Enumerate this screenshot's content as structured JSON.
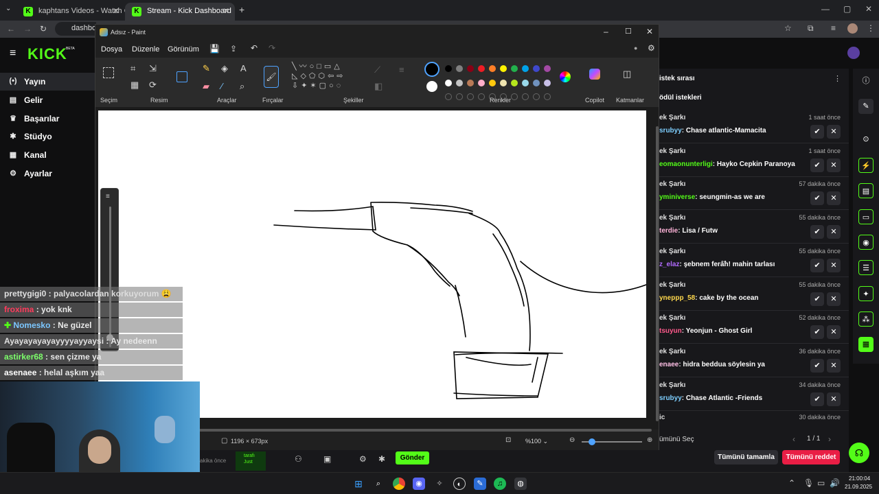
{
  "browser": {
    "tabs": [
      {
        "label": "kaphtans Videos - Watch On-D",
        "active": false
      },
      {
        "label": "Stream - Kick Dashboard",
        "active": true
      }
    ],
    "address": "dashboa"
  },
  "kick": {
    "logo": "KICK",
    "beta": "BETA",
    "nav": [
      {
        "label": "Yayın",
        "icon": "broadcast-icon",
        "glyph": "(•)"
      },
      {
        "label": "Gelir",
        "icon": "revenue-icon",
        "glyph": "▤"
      },
      {
        "label": "Başarılar",
        "icon": "trophy-icon",
        "glyph": "🏆"
      },
      {
        "label": "Stüdyo",
        "icon": "studio-icon",
        "glyph": "✱"
      },
      {
        "label": "Kanal",
        "icon": "channel-icon",
        "glyph": "▦"
      },
      {
        "label": "Ayarlar",
        "icon": "settings-icon",
        "glyph": "⚙"
      }
    ],
    "accent": "#53fc18"
  },
  "chat_overlay": [
    {
      "user": "prettygigi0",
      "color": "#e0e0e0",
      "text": "palyacolardan korkuyorum 😩"
    },
    {
      "user": "froxima",
      "color": "#ff3b5c",
      "text": "yok knk"
    },
    {
      "user": "Nomesko",
      "color": "#7cc7ff",
      "text": "Ne güzel",
      "badge": "✚"
    },
    {
      "user": "Ayayayayayayyyyayyaysi",
      "color": "#e0e0e0",
      "text": "Ay nedeenn"
    },
    {
      "user": "astirker68",
      "color": "#7dff6b",
      "text": "sen çizme ya"
    },
    {
      "user": "asenaee",
      "color": "#ffffff",
      "text": "helal aşkım yaa"
    }
  ],
  "paint": {
    "title": "Adsız - Paint",
    "menu": [
      "Dosya",
      "Düzenle",
      "Görünüm"
    ],
    "groups": [
      "Seçim",
      "Resim",
      "Araçlar",
      "Fırçalar",
      "Şekiller",
      "Renkler",
      "Copilot",
      "Katmanlar"
    ],
    "status_size": "1196 × 673px",
    "zoom": "%100",
    "colors_row1": [
      "#000000",
      "#7f7f7f",
      "#880015",
      "#ed1c24",
      "#ff7f27",
      "#fff200",
      "#22b14c",
      "#00a2e8",
      "#3f48cc",
      "#a349a4"
    ],
    "colors_row2": [
      "#ffffff",
      "#c3c3c3",
      "#b97a57",
      "#ffaec9",
      "#ffc90e",
      "#efe4b0",
      "#b5e61d",
      "#99d9ea",
      "#7092be",
      "#c8bfe7"
    ]
  },
  "requests": {
    "header": "istek sırası",
    "subheader": "ödül istekleri",
    "items": [
      {
        "title": "ek Şarkı",
        "time": "1 saat önce",
        "user": "srubyy",
        "user_color": "#7ecfff",
        "song": "Chase atlantic-Mamacita"
      },
      {
        "title": "ek Şarkı",
        "time": "1 saat önce",
        "user": "eomaonunterligi",
        "user_color": "#53fc18",
        "song": "Hayko Cepkin Paranoya"
      },
      {
        "title": "ek Şarkı",
        "time": "57 dakika önce",
        "user": "yminiverse",
        "user_color": "#53fc18",
        "song": "seungmin-as we are"
      },
      {
        "title": "ek Şarkı",
        "time": "55 dakika önce",
        "user": "terdie",
        "user_color": "#ffb3d9",
        "song": "Lisa / Futw"
      },
      {
        "title": "ek Şarkı",
        "time": "55 dakika önce",
        "user": "z_elaz",
        "user_color": "#b26bff",
        "song": "şebnem ferah! mahin tarlası"
      },
      {
        "title": "ek Şarkı",
        "time": "55 dakika önce",
        "user": "yneppp_58",
        "user_color": "#ffd84d",
        "song": "cake by the ocean"
      },
      {
        "title": "ek Şarkı",
        "time": "52 dakika önce",
        "user": "tsuyun",
        "user_color": "#ff5a8c",
        "song": "Yeonjun - Ghost Girl"
      },
      {
        "title": "ek Şarkı",
        "time": "36 dakika önce",
        "user": "enaee",
        "user_color": "#ffc0e6",
        "song": "hidra beddua söylesin ya"
      },
      {
        "title": "ek Şarkı",
        "time": "34 dakika önce",
        "user": "srubyy",
        "user_color": "#7ecfff",
        "song": "Chase Atlantic -Friends"
      }
    ],
    "last_partial": {
      "title": "ic",
      "time": "30 dakika önce"
    },
    "select_all": "ümünü Seç",
    "page": "1 / 1",
    "complete_all": "Tümünü tamamla",
    "reject_all": "Tümünü reddet"
  },
  "lower_bar": {
    "time_text": "akika önce",
    "partial": "tarafı\nJust",
    "send": "Gönder"
  },
  "taskbar": {
    "time": "21:00:04",
    "date": "21.09.2025"
  }
}
